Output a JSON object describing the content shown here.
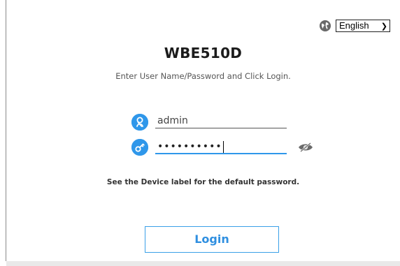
{
  "language": {
    "selected": "English",
    "icon": "globe-icon"
  },
  "header": {
    "title": "WBE510D",
    "subtitle": "Enter User Name/Password and Click Login."
  },
  "form": {
    "username_value": "admin",
    "username_icon": "user-icon",
    "password_masked": "••••••••••",
    "password_icon": "key-icon",
    "password_visibility_icon": "eye-slash-icon",
    "hint": "See the Device label for the default password.",
    "login_label": "Login"
  },
  "colors": {
    "accent": "#2f97ea",
    "title": "#1c1c1c",
    "button_border": "#3aa0e8"
  }
}
